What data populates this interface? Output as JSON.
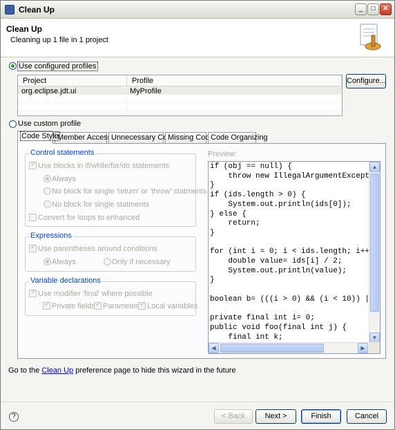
{
  "window": {
    "title": "Clean Up"
  },
  "header": {
    "title": "Clean Up",
    "description": "Cleaning up 1 file in 1 project"
  },
  "profiles": {
    "use_configured": "Use configured profiles",
    "configure_button": "Configure...",
    "columns": [
      "Project",
      "Profile"
    ],
    "rows": [
      {
        "project": "org.eclipse.jdt.ui",
        "profile": "MyProfile"
      }
    ],
    "use_custom": "Use custom profile",
    "selected": "use_configured"
  },
  "tabs": [
    "Code Style",
    "Member Accesses",
    "Unnecessary Code",
    "Missing Code",
    "Code Organizing"
  ],
  "active_tab": "Code Style",
  "control_statements": {
    "title": "Control statements",
    "use_blocks": "Use blocks in if/while/for/do statements",
    "always": "Always",
    "no_block_return": "No block for single 'return' or 'throw' statments",
    "no_block_single": "No block for single statments",
    "convert_loops": "Convert for loops to enhanced"
  },
  "expressions": {
    "title": "Expressions",
    "use_parentheses": "Use parentheses around conditions",
    "always": "Always",
    "only_if_necessary": "Only if necessary"
  },
  "variable_declarations": {
    "title": "Variable declarations",
    "use_final": "Use modifier 'final' where possible",
    "private_fields": "Private fields",
    "parameter": "Parameter",
    "local_variables": "Local variables"
  },
  "preview": {
    "label": "Preview:",
    "code": "if (obj == null) {\n    throw new IllegalArgumentExcepti\n}\nif (ids.length > 0) {\n    System.out.println(ids[0]);\n} else {\n    return;\n}\n\nfor (int i = 0; i < ids.length; i++)\n    double value= ids[i] / 2;\n    System.out.println(value);\n}\n\nboolean b= (((i > 0) && (i < 10)) ||\n\nprivate final int i= 0;\npublic void foo(final int j) {\n    final int k;"
  },
  "footer": {
    "prefix": "Go to the ",
    "link": "Clean Up",
    "suffix": " preference page to hide this wizard in the future"
  },
  "buttons": {
    "help": "?",
    "back": "< Back",
    "next": "Next >",
    "finish": "Finish",
    "cancel": "Cancel"
  },
  "scroll_arrows": {
    "up": "▲",
    "down": "▼",
    "left": "◀",
    "right": "▶"
  }
}
